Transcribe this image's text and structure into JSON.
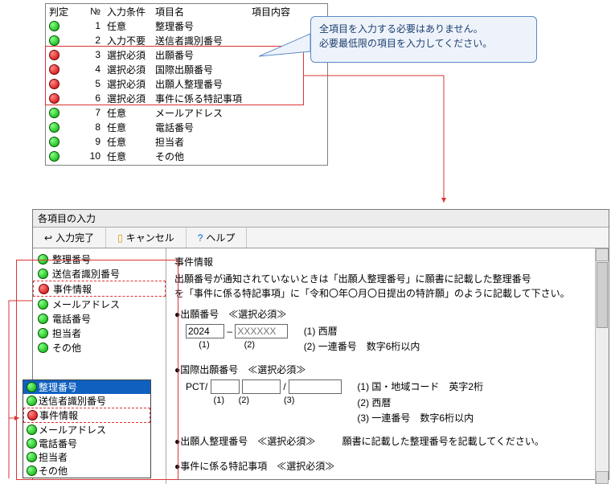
{
  "checklist": {
    "headers": {
      "st": "判定",
      "no": "№",
      "cond": "入力条件",
      "name": "項目名",
      "val": "項目内容"
    },
    "rows": [
      {
        "st": "g",
        "no": "1",
        "cond": "任意",
        "name": "整理番号"
      },
      {
        "st": "g",
        "no": "2",
        "cond": "入力不要",
        "name": "送信者識別番号"
      },
      {
        "st": "r",
        "no": "3",
        "cond": "選択必須",
        "name": "出願番号"
      },
      {
        "st": "r",
        "no": "4",
        "cond": "選択必須",
        "name": "国際出願番号"
      },
      {
        "st": "r",
        "no": "5",
        "cond": "選択必須",
        "name": "出願人整理番号"
      },
      {
        "st": "r",
        "no": "6",
        "cond": "選択必須",
        "name": "事件に係る特記事項"
      },
      {
        "st": "g",
        "no": "7",
        "cond": "任意",
        "name": "メールアドレス"
      },
      {
        "st": "g",
        "no": "8",
        "cond": "任意",
        "name": "電話番号"
      },
      {
        "st": "g",
        "no": "9",
        "cond": "任意",
        "name": "担当者"
      },
      {
        "st": "g",
        "no": "10",
        "cond": "任意",
        "name": "その他"
      }
    ]
  },
  "callout": {
    "l1": "全項目を入力する必要はありません。",
    "l2": "必要最低限の項目を入力してください。"
  },
  "panel": {
    "title": "各項目の入力"
  },
  "toolbar": {
    "complete": "入力完了",
    "cancel": "キャンセル",
    "help": "ヘルプ"
  },
  "tree": [
    {
      "st": "g",
      "label": "整理番号"
    },
    {
      "st": "g",
      "label": "送信者識別番号"
    },
    {
      "st": "r",
      "label": "事件情報",
      "hl": true
    },
    {
      "st": "g",
      "label": "メールアドレス"
    },
    {
      "st": "g",
      "label": "電話番号"
    },
    {
      "st": "g",
      "label": "担当者"
    },
    {
      "st": "g",
      "label": "その他"
    }
  ],
  "form": {
    "group_title": "事件情報",
    "note_l1": "出願番号が通知されていないときは「出願人整理番号」に願書に記載した整理番号",
    "note_l2": "を「事件に係る特記事項」に「令和〇年〇月〇日提出の特許願」のように記載して下さい。",
    "appno": {
      "label": "●出願番号　≪選択必須≫",
      "year": "2024",
      "num_ph": "XXXXXX",
      "sub1": "(1)",
      "sub2": "(2)",
      "rh1": "(1) 西暦",
      "rh2": "(2) 一連番号　数字6桁以内"
    },
    "intl": {
      "label": "●国際出願番号　≪選択必須≫",
      "pct": "PCT/",
      "slash": "/",
      "sub1": "(1)",
      "sub2": "(2)",
      "sub3": "(3)",
      "rh1": "(1) 国・地域コード　英字2桁",
      "rh2": "(2) 西暦",
      "rh3": "(3) 一連番号　数字6桁以内"
    },
    "applicant": {
      "label": "●出願人整理番号　≪選択必須≫",
      "rh": "願書に記載した整理番号を記載してください。"
    },
    "remarks": {
      "label": "●事件に係る特記事項　≪選択必須≫"
    }
  },
  "dropdown": [
    {
      "st": "g",
      "label": "整理番号",
      "sel": true
    },
    {
      "st": "g",
      "label": "送信者識別番号"
    },
    {
      "st": "r",
      "label": "事件情報",
      "hl": true
    },
    {
      "st": "g",
      "label": "メールアドレス"
    },
    {
      "st": "g",
      "label": "電話番号"
    },
    {
      "st": "g",
      "label": "担当者"
    },
    {
      "st": "g",
      "label": "その他"
    }
  ]
}
